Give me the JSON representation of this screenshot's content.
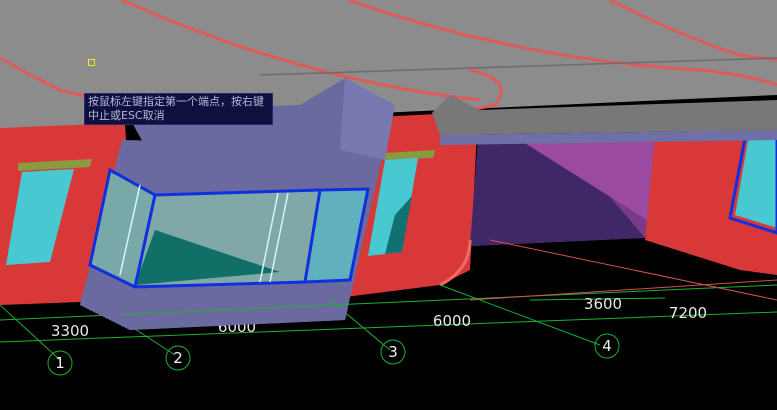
{
  "tooltip": {
    "text": "按鼠标左键指定第一个端点，按右键中止或ESC取消"
  },
  "dimensions": {
    "d1": "3300",
    "d2": "6000",
    "d3": "6000",
    "d4": "3600",
    "d5": "7200"
  },
  "axes": [
    "1",
    "2",
    "3",
    "4"
  ],
  "colors": {
    "background": "#000000",
    "ceiling": "#8c8c8c",
    "wall": "#d83838",
    "bay_window": "#6a6aa0",
    "glass": "#48c8d0",
    "grid_line": "#20b030",
    "tooltip_bg": "#101040",
    "cursor": "#f0f000"
  }
}
